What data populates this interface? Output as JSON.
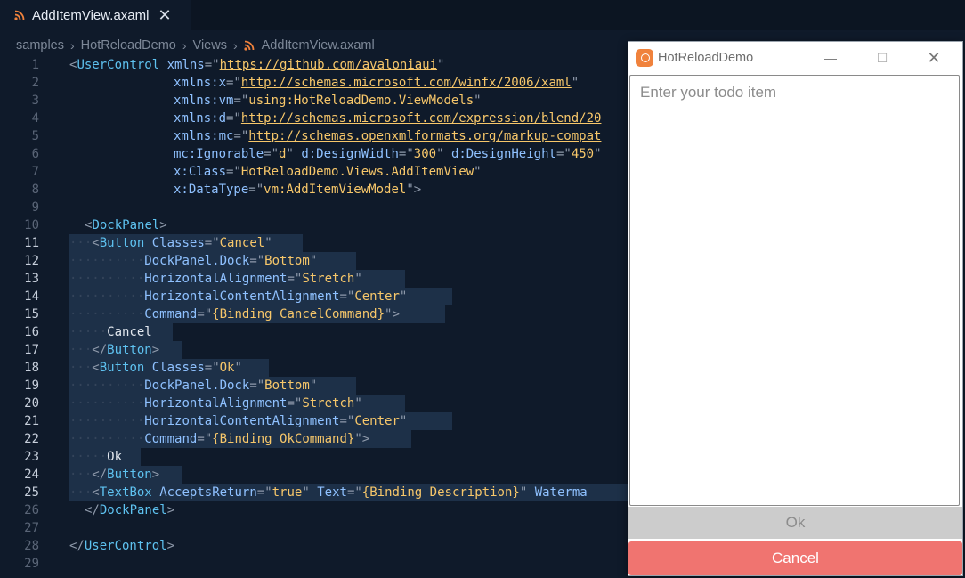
{
  "editor": {
    "tab": {
      "title": "AddItemView.axaml",
      "close": "✕"
    },
    "breadcrumb": [
      "samples",
      "HotReloadDemo",
      "Views",
      "AddItemView.axaml"
    ],
    "line_numbers": [
      "1",
      "2",
      "3",
      "4",
      "5",
      "6",
      "7",
      "8",
      "9",
      "10",
      "11",
      "12",
      "13",
      "14",
      "15",
      "16",
      "17",
      "18",
      "19",
      "20",
      "21",
      "22",
      "23",
      "24",
      "25",
      "26",
      "27",
      "28",
      "29"
    ],
    "active_lines": [
      11,
      12,
      13,
      14,
      15,
      16,
      17,
      18,
      19,
      20,
      21,
      22,
      23,
      24,
      25
    ]
  },
  "code_text": {
    "l1_tag": "UserControl",
    "l1_attr": "xmlns",
    "l1_val": "https://github.com/avaloniaui",
    "l2_attr": "xmlns:x",
    "l2_val": "http://schemas.microsoft.com/winfx/2006/xaml",
    "l3_attr": "xmlns:vm",
    "l3_val": "using:HotReloadDemo.ViewModels",
    "l4_attr": "xmlns:d",
    "l4_val": "http://schemas.microsoft.com/expression/blend/20",
    "l5_attr": "xmlns:mc",
    "l5_val": "http://schemas.openxmlformats.org/markup-compat",
    "l6_attr1": "mc:Ignorable",
    "l6_val1": "d",
    "l6_attr2": "d:DesignWidth",
    "l6_val2": "300",
    "l6_attr3": "d:DesignHeight",
    "l6_val3": "450",
    "l7_attr": "x:Class",
    "l7_val": "HotReloadDemo.Views.AddItemView",
    "l8_attr": "x:DataType",
    "l8_val": "vm:AddItemViewModel",
    "dockpanel_tag": "DockPanel",
    "button_tag": "Button",
    "classes_attr": "Classes",
    "cancel_class": "Cancel",
    "ok_class": "Ok",
    "dock_attr": "DockPanel.Dock",
    "dock_val": "Bottom",
    "halign_attr": "HorizontalAlignment",
    "halign_val": "Stretch",
    "hcalign_attr": "HorizontalContentAlignment",
    "hcalign_val": "Center",
    "command_attr": "Command",
    "cancel_cmd": "{Binding CancelCommand}",
    "ok_cmd": "{Binding OkCommand}",
    "cancel_text": "Cancel",
    "ok_text": "Ok",
    "textbox_tag": "TextBox",
    "accepts_attr": "AcceptsReturn",
    "accepts_val": "true",
    "text_attr": "Text",
    "text_val": "{Binding Description}",
    "watermark_attr": "Waterma",
    "usercontrol_close": "UserControl"
  },
  "app_window": {
    "title": "HotReloadDemo",
    "minimize": "—",
    "maximize": "☐",
    "close": "✕",
    "input_placeholder": "Enter your todo item",
    "ok_label": "Ok",
    "cancel_label": "Cancel"
  },
  "colors": {
    "editor_bg": "#0f1a2a",
    "selection": "#1d3048",
    "tag": "#5ec2f0",
    "attribute": "#8fc1ff",
    "string": "#f7c76a",
    "cancel_button": "#f07470",
    "ok_button": "#cccccc"
  },
  "icons": {
    "file": "rss-icon",
    "app": "avalonia-app-icon"
  }
}
